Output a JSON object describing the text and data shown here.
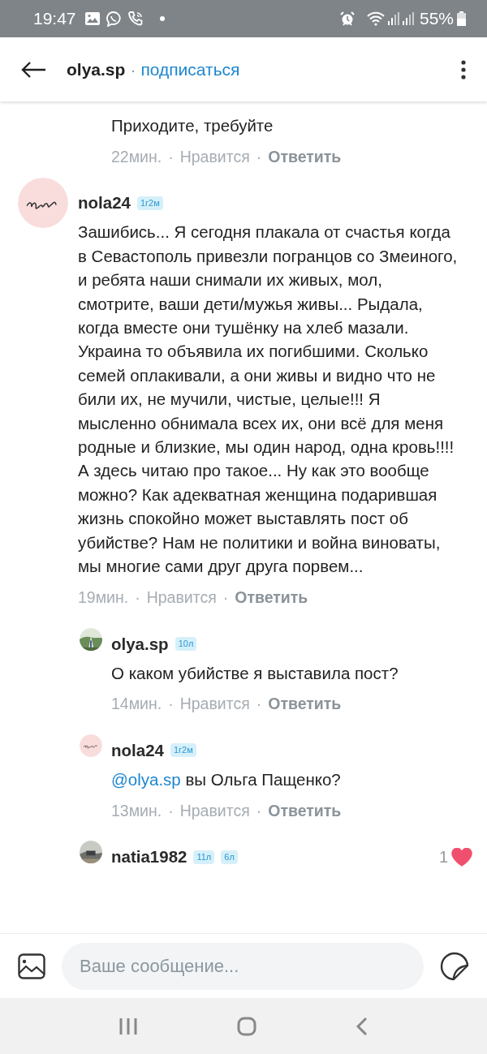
{
  "status_bar": {
    "time": "19:47",
    "battery": "55%"
  },
  "header": {
    "username": "olya.sp",
    "separator": "·",
    "follow": "подписаться"
  },
  "separator": "·",
  "comments": [
    {
      "kind": "reply",
      "text": "Приходите, требуйте",
      "time": "22мин.",
      "like": "Нравится",
      "reply": "Ответить"
    },
    {
      "kind": "comment",
      "avatar": {
        "kind": "picture"
      },
      "author": "nola24",
      "badges": [
        "1г2м"
      ],
      "text": "Зашибись... Я сегодня плакала от счастья когда в Севастополь привезли погранцов со Змеиного, и ребята наши снимали их живых, мол, смотрите, ваши дети/мужья живы... Рыдала, когда вместе они тушёнку на хлеб мазали.\nУкраина то объявила их погибшими. Сколько семей оплакивали, а они живы и видно что не били их, не мучили, чистые, целые!!! Я мысленно обнимала всех их, они всё для меня родные и близкие, мы один народ, одна кровь!!!!\nА здесь читаю про такое... Ну как это вообще можно? Как адекватная женщина подарившая жизнь спокойно может выставлять пост об убийстве? Нам не политики и война виноваты, мы многие сами друг друга порвем...",
      "time": "19мин.",
      "like": "Нравится",
      "reply": "Ответить"
    },
    {
      "kind": "reply",
      "avatar": {
        "kind": "picture"
      },
      "author": "olya.sp",
      "badges": [
        "10л"
      ],
      "text": "О каком убийстве я выставила пост?",
      "time": "14мин.",
      "like": "Нравится",
      "reply": "Ответить"
    },
    {
      "kind": "reply",
      "avatar": {
        "kind": "picture"
      },
      "author": "nola24",
      "badges": [
        "1г2м"
      ],
      "mention": "@olya.sp",
      "text": "вы Ольга Пащенко?",
      "time": "13мин.",
      "like": "Нравится",
      "reply": "Ответить"
    },
    {
      "kind": "reply",
      "avatar": {
        "kind": "picture"
      },
      "author": "natia1982",
      "badges": [
        "11л",
        "6л"
      ],
      "likes": "1",
      "liked": true
    }
  ],
  "composer": {
    "placeholder": "Ваше сообщение..."
  }
}
